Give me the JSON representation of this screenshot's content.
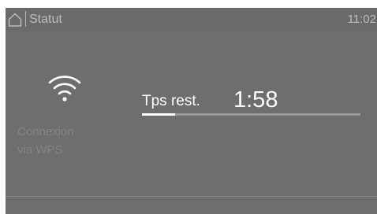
{
  "status_bar": {
    "icon": "home-icon",
    "title": "Statut",
    "clock": "11:02"
  },
  "wps": {
    "icon": "wifi-icon",
    "line1": "Connexion",
    "line2": "via WPS"
  },
  "program": {
    "time_label": "Tps rest.",
    "time_value": "1:58",
    "progress_fraction": 0.15
  },
  "colors": {
    "background": "#6e6e6e",
    "text_primary": "#ffffff",
    "text_dim": "#bdbdbd",
    "text_disabled": "#858585",
    "progress_track": "#9a9a9a"
  }
}
